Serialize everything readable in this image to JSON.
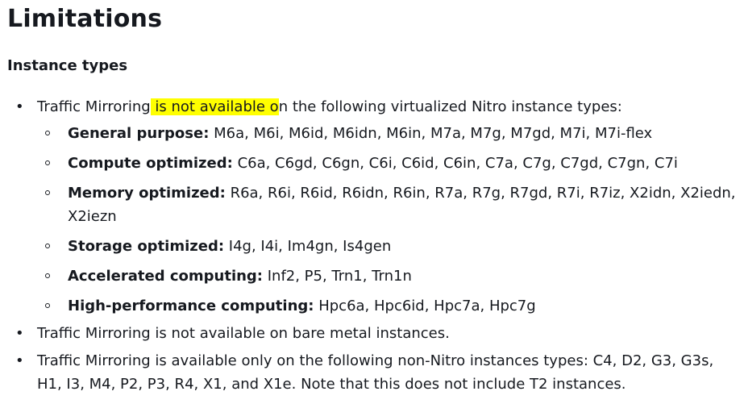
{
  "page": {
    "title": "Limitations",
    "subtitle": "Instance types"
  },
  "list": {
    "bullet_glyph": "•",
    "item_nitro": {
      "before": "Traffic Mirroring",
      "highlight": " is not available o",
      "after": "n the following virtualized Nitro instance types:",
      "highlight_color": "#ffff00",
      "subitems": [
        {
          "label": "General purpose:",
          "value": " M6a, M6i, M6id, M6idn, M6in, M7a, M7g, M7gd, M7i, M7i-flex"
        },
        {
          "label": "Compute optimized:",
          "value": " C6a, C6gd, C6gn, C6i, C6id, C6in, C7a, C7g, C7gd, C7gn, C7i"
        },
        {
          "label": "Memory optimized:",
          "value": " R6a, R6i, R6id, R6idn, R6in, R7a, R7g, R7gd, R7i, R7iz, X2idn, X2iedn, X2iezn"
        },
        {
          "label": "Storage optimized:",
          "value": " I4g, I4i, Im4gn, Is4gen"
        },
        {
          "label": "Accelerated computing:",
          "value": " Inf2, P5, Trn1, Trn1n"
        },
        {
          "label": "High-performance computing:",
          "value": " Hpc6a, Hpc6id, Hpc7a, Hpc7g"
        }
      ]
    },
    "item_bare_metal": "Traffic Mirroring is not available on bare metal instances.",
    "item_non_nitro": "Traffic Mirroring is available only on the following non-Nitro instances types: C4, D2, G3, G3s, H1, I3, M4, P2, P3, R4, X1, and X1e. Note that this does not include T2 instances."
  },
  "colors": {
    "text": "#16191f",
    "background": "#ffffff",
    "highlight": "#ffff00"
  }
}
